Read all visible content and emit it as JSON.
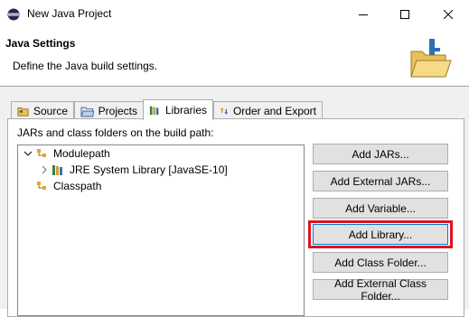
{
  "window": {
    "title": "New Java Project",
    "controls": [
      "minimize",
      "maximize",
      "close"
    ]
  },
  "header": {
    "title": "Java Settings",
    "description": "Define the Java build settings."
  },
  "tabs": [
    {
      "label": "Source",
      "icon": "source-folder-icon",
      "active": false
    },
    {
      "label": "Projects",
      "icon": "projects-icon",
      "active": false
    },
    {
      "label": "Libraries",
      "icon": "libraries-icon",
      "active": true
    },
    {
      "label": "Order and Export",
      "icon": "order-export-icon",
      "active": false
    }
  ],
  "libraries": {
    "label": "JARs and class folders on the build path:",
    "tree": [
      {
        "label": "Modulepath",
        "expanded": true,
        "icon": "path-icon"
      },
      {
        "label": "JRE System Library [JavaSE-10]",
        "expanded": false,
        "icon": "library-icon"
      },
      {
        "label": "Classpath",
        "icon": "path-icon"
      }
    ],
    "buttons": [
      {
        "label": "Add JARs..."
      },
      {
        "label": "Add External JARs..."
      },
      {
        "label": "Add Variable..."
      },
      {
        "label": "Add Library...",
        "highlighted": true
      },
      {
        "label": "Add Class Folder..."
      },
      {
        "label": "Add External Class Folder..."
      }
    ]
  },
  "colors": {
    "highlight": "#e0121e",
    "panel_bg": "#f0f0f0",
    "button_bg": "#e1e1e1"
  }
}
